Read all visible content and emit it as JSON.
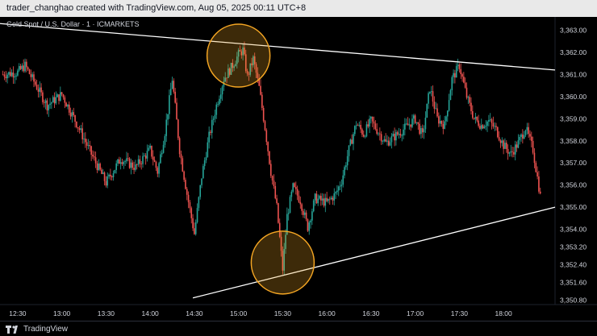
{
  "caption": "trader_changhao created with TradingView.com, Aug 05, 2025 00:11 UTC+8",
  "symbol_title": "Gold Spot / U.S. Dollar · 1 · ICMARKETS",
  "brand": "TradingView",
  "colors": {
    "up": "#26a69a",
    "down": "#ef5350",
    "trendline": "#ffffff",
    "highlight": "#f5a623"
  },
  "chart_data": {
    "type": "candlestick",
    "title": "Gold Spot / U.S. Dollar · 1 · ICMARKETS",
    "x_ticks": [
      "12:30",
      "13:00",
      "13:30",
      "14:00",
      "14:30",
      "15:00",
      "15:30",
      "16:00",
      "16:30",
      "17:00",
      "17:30",
      "18:00"
    ],
    "y_ticks": [
      "3,363.00",
      "3,362.00",
      "3,361.00",
      "3,360.00",
      "3,359.00",
      "3,358.00",
      "3,357.00",
      "3,356.00",
      "3,355.00",
      "3,354.00",
      "3,353.20",
      "3,352.40",
      "3,351.60",
      "3,350.80"
    ],
    "ylim": [
      3350.6,
      3363.6
    ],
    "xlim": [
      "12:18",
      "18:35"
    ],
    "close_profile": [
      [
        "12:20",
        3361.0
      ],
      [
        "12:30",
        3361.1
      ],
      [
        "12:35",
        3361.4
      ],
      [
        "12:40",
        3360.8
      ],
      [
        "12:50",
        3359.6
      ],
      [
        "13:00",
        3360.1
      ],
      [
        "13:10",
        3358.8
      ],
      [
        "13:20",
        3357.4
      ],
      [
        "13:30",
        3356.1
      ],
      [
        "13:40",
        3357.2
      ],
      [
        "13:50",
        3356.8
      ],
      [
        "14:00",
        3357.6
      ],
      [
        "14:05",
        3356.6
      ],
      [
        "14:10",
        3358.4
      ],
      [
        "14:15",
        3360.8
      ],
      [
        "14:20",
        3357.6
      ],
      [
        "14:25",
        3355.6
      ],
      [
        "14:30",
        3353.8
      ],
      [
        "14:35",
        3356.4
      ],
      [
        "14:40",
        3358.2
      ],
      [
        "14:45",
        3359.6
      ],
      [
        "14:50",
        3360.8
      ],
      [
        "14:55",
        3361.3
      ],
      [
        "15:00",
        3361.9
      ],
      [
        "15:03",
        3362.1
      ],
      [
        "15:06",
        3360.9
      ],
      [
        "15:10",
        3361.7
      ],
      [
        "15:14",
        3360.4
      ],
      [
        "15:18",
        3358.6
      ],
      [
        "15:22",
        3356.6
      ],
      [
        "15:26",
        3355.0
      ],
      [
        "15:30",
        3352.2
      ],
      [
        "15:33",
        3354.6
      ],
      [
        "15:37",
        3355.9
      ],
      [
        "15:42",
        3355.3
      ],
      [
        "15:47",
        3354.1
      ],
      [
        "15:52",
        3355.4
      ],
      [
        "16:00",
        3355.2
      ],
      [
        "16:06",
        3355.6
      ],
      [
        "16:10",
        3356.2
      ],
      [
        "16:15",
        3357.6
      ],
      [
        "16:20",
        3358.8
      ],
      [
        "16:25",
        3358.3
      ],
      [
        "16:30",
        3358.9
      ],
      [
        "16:40",
        3357.9
      ],
      [
        "16:50",
        3358.4
      ],
      [
        "17:00",
        3359.0
      ],
      [
        "17:05",
        3358.2
      ],
      [
        "17:10",
        3360.4
      ],
      [
        "17:15",
        3359.0
      ],
      [
        "17:20",
        3358.7
      ],
      [
        "17:25",
        3360.8
      ],
      [
        "17:30",
        3361.4
      ],
      [
        "17:35",
        3360.0
      ],
      [
        "17:40",
        3359.0
      ],
      [
        "17:45",
        3358.7
      ],
      [
        "17:50",
        3358.9
      ],
      [
        "17:55",
        3358.5
      ],
      [
        "18:00",
        3357.8
      ],
      [
        "18:05",
        3357.4
      ],
      [
        "18:10",
        3357.9
      ],
      [
        "18:15",
        3358.6
      ],
      [
        "18:20",
        3357.6
      ],
      [
        "18:25",
        3355.5
      ]
    ],
    "trendlines": [
      {
        "name": "upper",
        "from": [
          "12:18",
          3363.3
        ],
        "to": [
          "18:35",
          3361.2
        ]
      },
      {
        "name": "lower",
        "from": [
          "14:29",
          3350.9
        ],
        "to": [
          "18:35",
          3355.0
        ]
      }
    ],
    "highlight_circles": [
      {
        "name": "top",
        "at": [
          "15:00",
          3361.85
        ]
      },
      {
        "name": "bottom",
        "at": [
          "15:30",
          3352.5
        ]
      }
    ],
    "grid": false,
    "legend": "none"
  }
}
